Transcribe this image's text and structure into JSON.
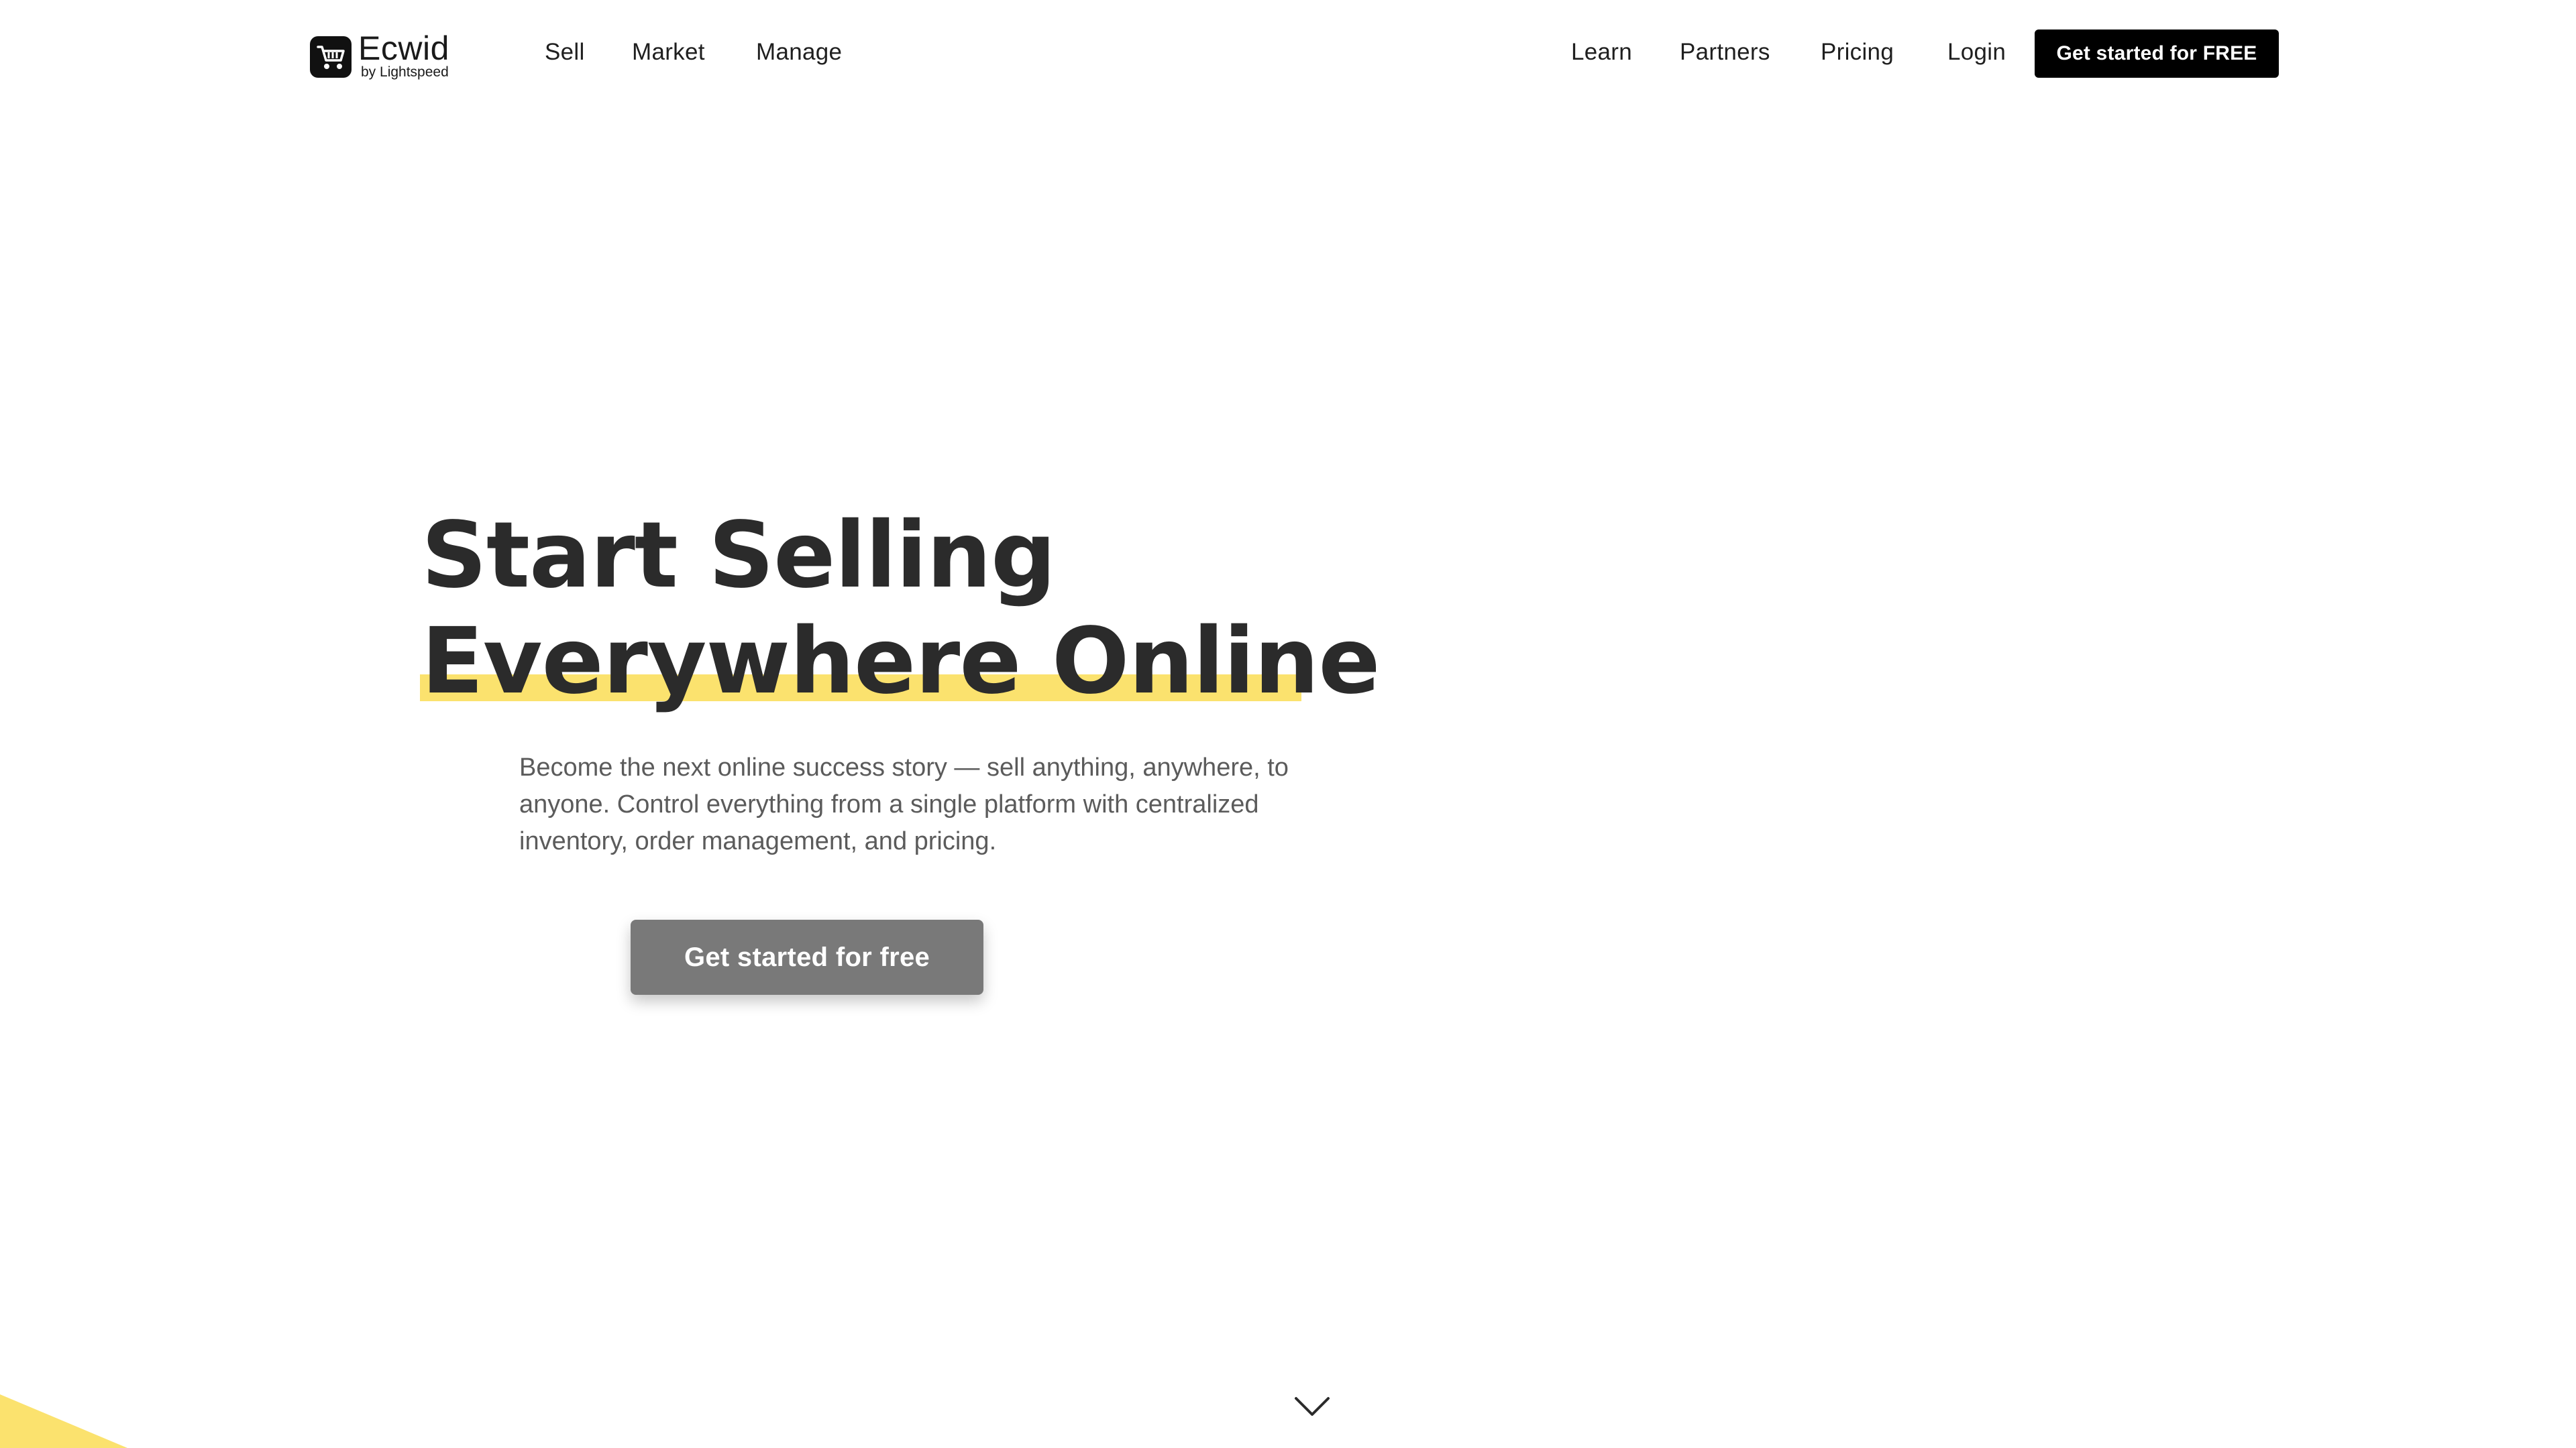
{
  "colors": {
    "accent_yellow": "#fbe26e",
    "dark": "#000000",
    "text": "#2b2b2b",
    "muted_text": "#5b5b5b",
    "primary_button": "#797979"
  },
  "header": {
    "logo": {
      "word": "Ecwid",
      "sub": "by Lightspeed",
      "icon": "cart-icon"
    },
    "left_nav": [
      {
        "label": "Sell"
      },
      {
        "label": "Market"
      },
      {
        "label": "Manage"
      }
    ],
    "right_nav": [
      {
        "label": "Learn"
      },
      {
        "label": "Partners"
      },
      {
        "label": "Pricing"
      },
      {
        "label": "Login"
      }
    ],
    "cta_label": "Get started for FREE"
  },
  "hero": {
    "title_line1": "Start Selling",
    "title_line2": "Everywhere Online",
    "description": "Become the next online success story — sell anything, anywhere, to anyone. Control everything from a single platform with centralized inventory, order management, and pricing.",
    "cta_label": "Get started for free"
  },
  "scroll_indicator": {
    "icon": "chevron-down-icon"
  }
}
